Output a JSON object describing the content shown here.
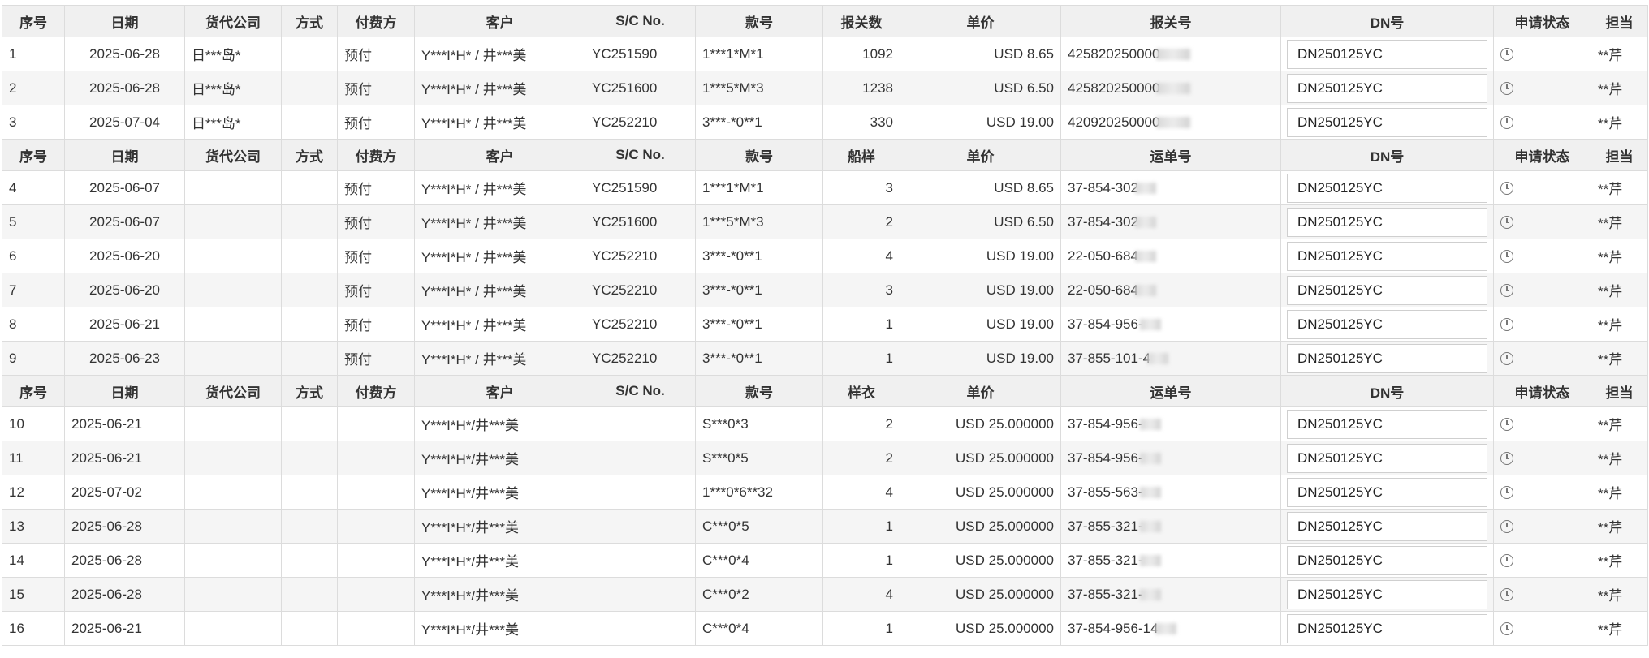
{
  "headers": {
    "seq": "序号",
    "date": "日期",
    "forwarder": "货代公司",
    "method": "方式",
    "payer": "付费方",
    "customer": "客户",
    "sc": "S/C No.",
    "style": "款号",
    "qty1": "报关数",
    "qty2": "船样",
    "qty3": "样衣",
    "price": "单价",
    "ref1": "报关号",
    "ref2": "运单号",
    "ref3": "运单号",
    "dn": "DN号",
    "status": "申请状态",
    "owner": "担当"
  },
  "section1": [
    {
      "seq": "1",
      "date": "2025-06-28",
      "forwarder": "日***岛*",
      "method": "",
      "payer": "预付",
      "customer": "Y***I*H* / 井***美",
      "sc": "YC251590",
      "style": "1***1*M*1",
      "qty": "1092",
      "price": "USD 8.65",
      "ref": "425820250000",
      "dn": "DN250125YC",
      "owner": "**芹"
    },
    {
      "seq": "2",
      "date": "2025-06-28",
      "forwarder": "日***岛*",
      "method": "",
      "payer": "预付",
      "customer": "Y***I*H* / 井***美",
      "sc": "YC251600",
      "style": "1***5*M*3",
      "qty": "1238",
      "price": "USD 6.50",
      "ref": "425820250000",
      "dn": "DN250125YC",
      "owner": "**芹"
    },
    {
      "seq": "3",
      "date": "2025-07-04",
      "forwarder": "日***岛*",
      "method": "",
      "payer": "预付",
      "customer": "Y***I*H* / 井***美",
      "sc": "YC252210",
      "style": "3***-*0**1",
      "qty": "330",
      "price": "USD 19.00",
      "ref": "420920250000",
      "dn": "DN250125YC",
      "owner": "**芹"
    }
  ],
  "section2": [
    {
      "seq": "4",
      "date": "2025-06-07",
      "forwarder": "",
      "method": "",
      "payer": "预付",
      "customer": "Y***I*H* / 井***美",
      "sc": "YC251590",
      "style": "1***1*M*1",
      "qty": "3",
      "price": "USD 8.65",
      "ref": "37-854-302",
      "dn": "DN250125YC",
      "owner": "**芹"
    },
    {
      "seq": "5",
      "date": "2025-06-07",
      "forwarder": "",
      "method": "",
      "payer": "预付",
      "customer": "Y***I*H* / 井***美",
      "sc": "YC251600",
      "style": "1***5*M*3",
      "qty": "2",
      "price": "USD 6.50",
      "ref": "37-854-302",
      "dn": "DN250125YC",
      "owner": "**芹"
    },
    {
      "seq": "6",
      "date": "2025-06-20",
      "forwarder": "",
      "method": "",
      "payer": "预付",
      "customer": "Y***I*H* / 井***美",
      "sc": "YC252210",
      "style": "3***-*0**1",
      "qty": "4",
      "price": "USD 19.00",
      "ref": "22-050-684",
      "dn": "DN250125YC",
      "owner": "**芹"
    },
    {
      "seq": "7",
      "date": "2025-06-20",
      "forwarder": "",
      "method": "",
      "payer": "预付",
      "customer": "Y***I*H* / 井***美",
      "sc": "YC252210",
      "style": "3***-*0**1",
      "qty": "3",
      "price": "USD 19.00",
      "ref": "22-050-684",
      "dn": "DN250125YC",
      "owner": "**芹"
    },
    {
      "seq": "8",
      "date": "2025-06-21",
      "forwarder": "",
      "method": "",
      "payer": "预付",
      "customer": "Y***I*H* / 井***美",
      "sc": "YC252210",
      "style": "3***-*0**1",
      "qty": "1",
      "price": "USD 19.00",
      "ref": "37-854-956-",
      "dn": "DN250125YC",
      "owner": "**芹"
    },
    {
      "seq": "9",
      "date": "2025-06-23",
      "forwarder": "",
      "method": "",
      "payer": "预付",
      "customer": "Y***I*H* / 井***美",
      "sc": "YC252210",
      "style": "3***-*0**1",
      "qty": "1",
      "price": "USD 19.00",
      "ref": "37-855-101-4",
      "dn": "DN250125YC",
      "owner": "**芹"
    }
  ],
  "section3": [
    {
      "seq": "10",
      "date": "2025-06-21",
      "forwarder": "",
      "method": "",
      "payer": "",
      "customer": "Y***I*H*/井***美",
      "sc": "",
      "style": "S***0*3",
      "qty": "2",
      "price": "USD 25.000000",
      "ref": "37-854-956-",
      "dn": "DN250125YC",
      "owner": "**芹"
    },
    {
      "seq": "11",
      "date": "2025-06-21",
      "forwarder": "",
      "method": "",
      "payer": "",
      "customer": "Y***I*H*/井***美",
      "sc": "",
      "style": "S***0*5",
      "qty": "2",
      "price": "USD 25.000000",
      "ref": "37-854-956-",
      "dn": "DN250125YC",
      "owner": "**芹"
    },
    {
      "seq": "12",
      "date": "2025-07-02",
      "forwarder": "",
      "method": "",
      "payer": "",
      "customer": "Y***I*H*/井***美",
      "sc": "",
      "style": "1***0*6**32",
      "qty": "4",
      "price": "USD 25.000000",
      "ref": "37-855-563-",
      "dn": "DN250125YC",
      "owner": "**芹"
    },
    {
      "seq": "13",
      "date": "2025-06-28",
      "forwarder": "",
      "method": "",
      "payer": "",
      "customer": "Y***I*H*/井***美",
      "sc": "",
      "style": "C***0*5",
      "qty": "1",
      "price": "USD 25.000000",
      "ref": "37-855-321-",
      "dn": "DN250125YC",
      "owner": "**芹"
    },
    {
      "seq": "14",
      "date": "2025-06-28",
      "forwarder": "",
      "method": "",
      "payer": "",
      "customer": "Y***I*H*/井***美",
      "sc": "",
      "style": "C***0*4",
      "qty": "1",
      "price": "USD 25.000000",
      "ref": "37-855-321-",
      "dn": "DN250125YC",
      "owner": "**芹"
    },
    {
      "seq": "15",
      "date": "2025-06-28",
      "forwarder": "",
      "method": "",
      "payer": "",
      "customer": "Y***I*H*/井***美",
      "sc": "",
      "style": "C***0*2",
      "qty": "4",
      "price": "USD 25.000000",
      "ref": "37-855-321-",
      "dn": "DN250125YC",
      "owner": "**芹"
    },
    {
      "seq": "16",
      "date": "2025-06-21",
      "forwarder": "",
      "method": "",
      "payer": "",
      "customer": "Y***I*H*/井***美",
      "sc": "",
      "style": "C***0*4",
      "qty": "1",
      "price": "USD 25.000000",
      "ref": "37-854-956-14",
      "dn": "DN250125YC",
      "owner": "**芹"
    }
  ],
  "status_icon": "clock-icon"
}
